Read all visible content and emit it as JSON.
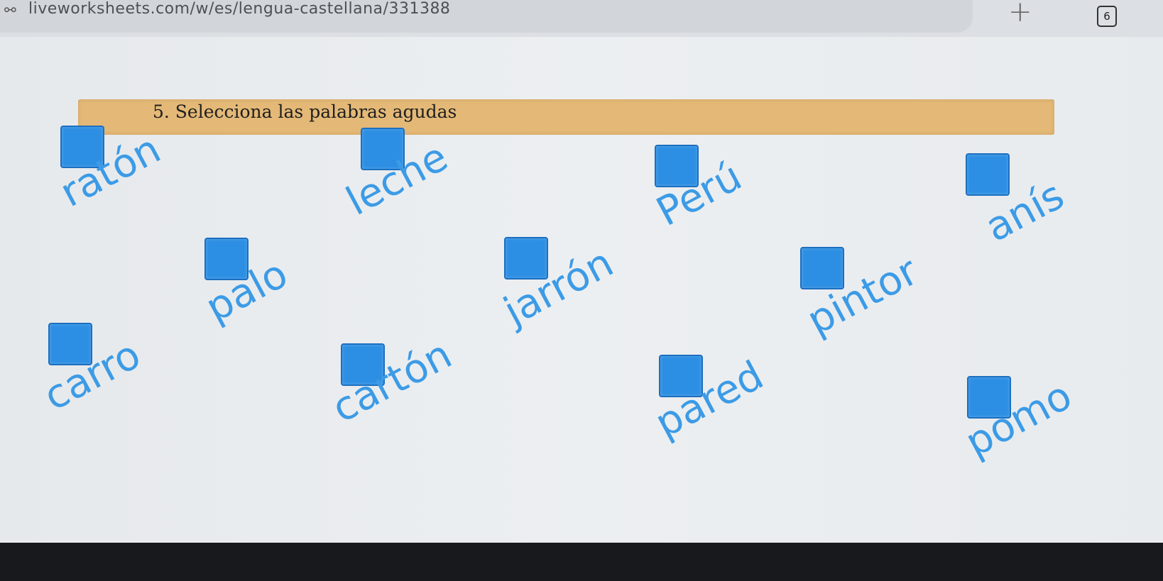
{
  "browser": {
    "url": "liveworksheets.com/w/es/lengua-castellana/331388",
    "new_tab_symbol": "+",
    "tab_count": "6"
  },
  "worksheet": {
    "instruction": "5.  Selecciona las palabras agudas",
    "words": [
      "ratón",
      "leche",
      "Perú",
      "anís",
      "palo",
      "jarrón",
      "pintor",
      "carro",
      "cartón",
      "pared",
      "pomo"
    ]
  },
  "colors": {
    "word_text": "#3c9be6",
    "checkbox": "#2d8fe3",
    "header_band": "#e4b977"
  }
}
